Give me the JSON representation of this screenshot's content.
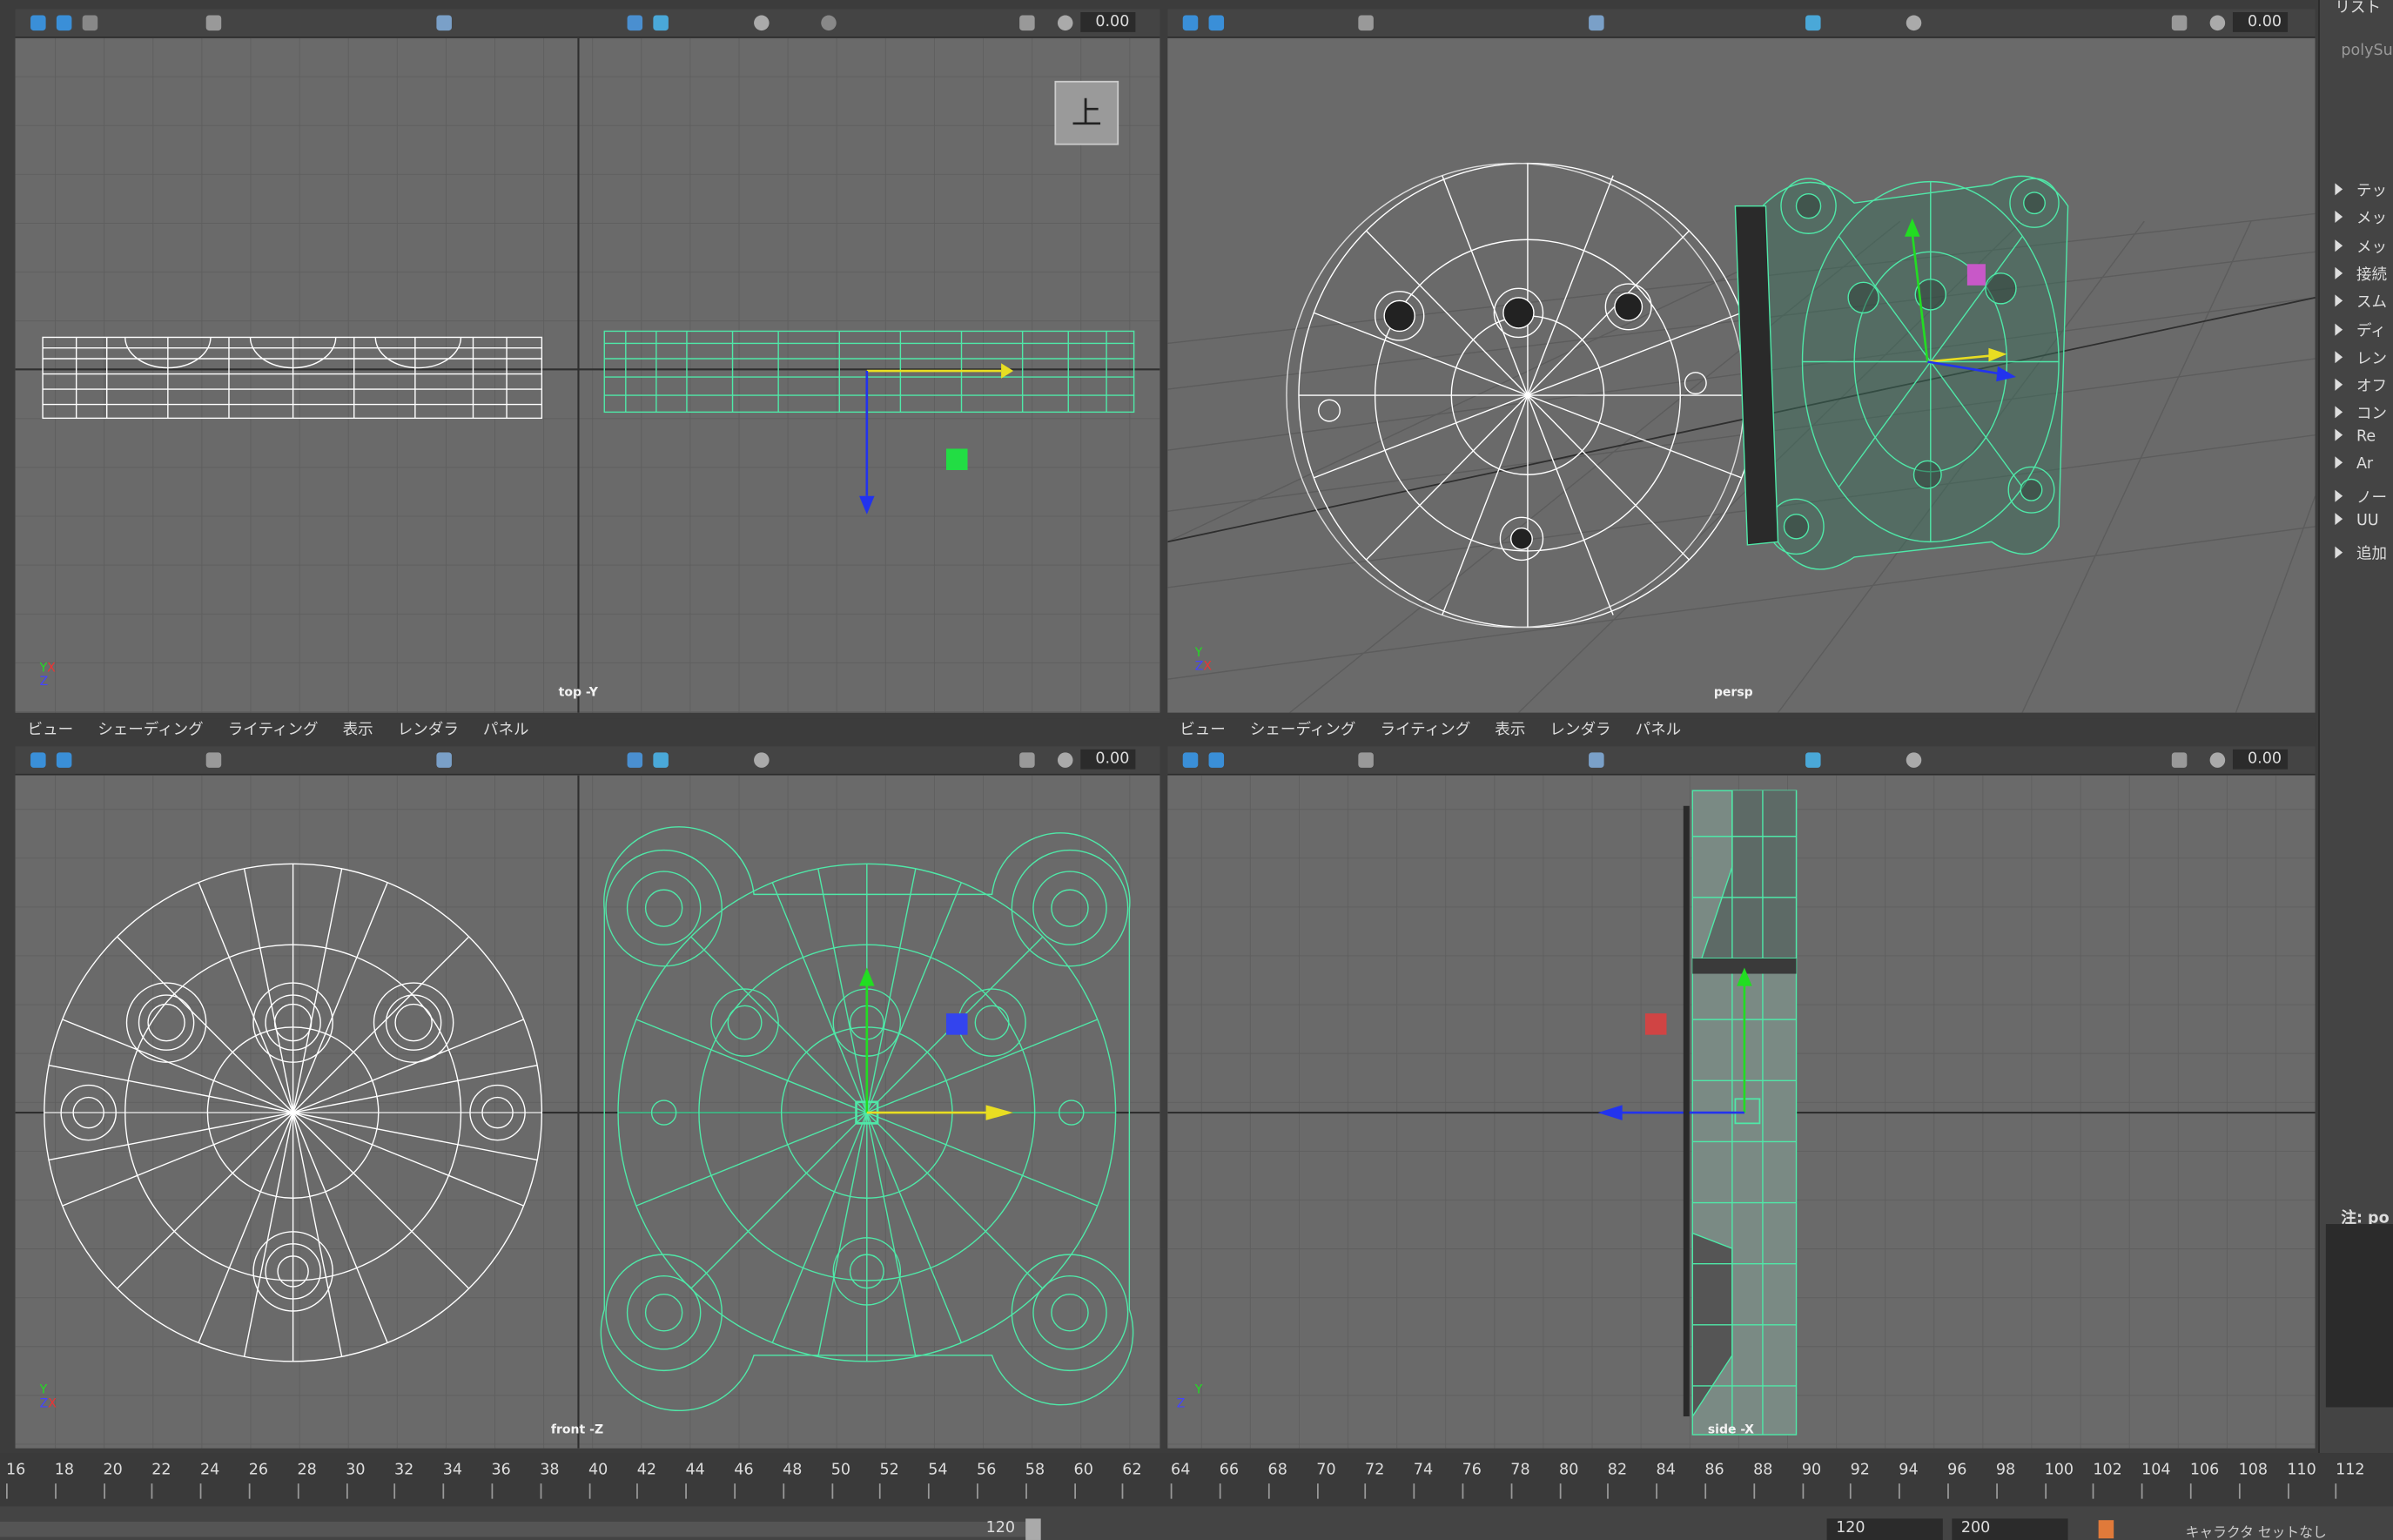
{
  "menu": [
    "ビュー",
    "シェーディング",
    "ライティング",
    "表示",
    "レンダラ",
    "パネル"
  ],
  "toolbar_field": "0.00",
  "viewports": {
    "top": {
      "camera": "top -Y",
      "cube_label": "上"
    },
    "persp": {
      "camera": "persp"
    },
    "front": {
      "camera": "front -Z"
    },
    "side": {
      "camera": "side -X"
    }
  },
  "axes": {
    "x": "X",
    "y": "Y",
    "z": "Z"
  },
  "right_panel": {
    "header": "リスト",
    "node": "polySu",
    "sections": [
      "テッ",
      "メッ",
      "メッ",
      "接続",
      "スム",
      "ディ",
      "レン",
      "オフ",
      "コン",
      "Re",
      "Ar",
      "ノー",
      "UU",
      "追加"
    ],
    "note": "注: po"
  },
  "timeline": {
    "ticks": [
      16,
      18,
      20,
      22,
      24,
      26,
      28,
      30,
      32,
      34,
      36,
      38,
      40,
      42,
      44,
      46,
      48,
      50,
      52,
      54,
      56,
      58,
      60,
      62,
      64,
      66,
      68,
      70,
      72,
      74,
      76,
      78,
      80,
      82,
      84,
      86,
      88,
      90,
      92,
      94,
      96,
      98,
      100,
      102,
      104,
      106,
      108,
      110,
      112
    ]
  },
  "range": {
    "current_end": "120",
    "end": "120",
    "max": "200",
    "character_set": "キャラクタ セットなし"
  },
  "colors": {
    "viewport_bg": "#6a6a6a",
    "selected_wire": "#4fe8a8",
    "wire": "#ffffff",
    "grid": "#5d5d5d",
    "axis_y": "#22dd22",
    "axis_x": "#eedd22",
    "axis_z": "#2233ee"
  }
}
